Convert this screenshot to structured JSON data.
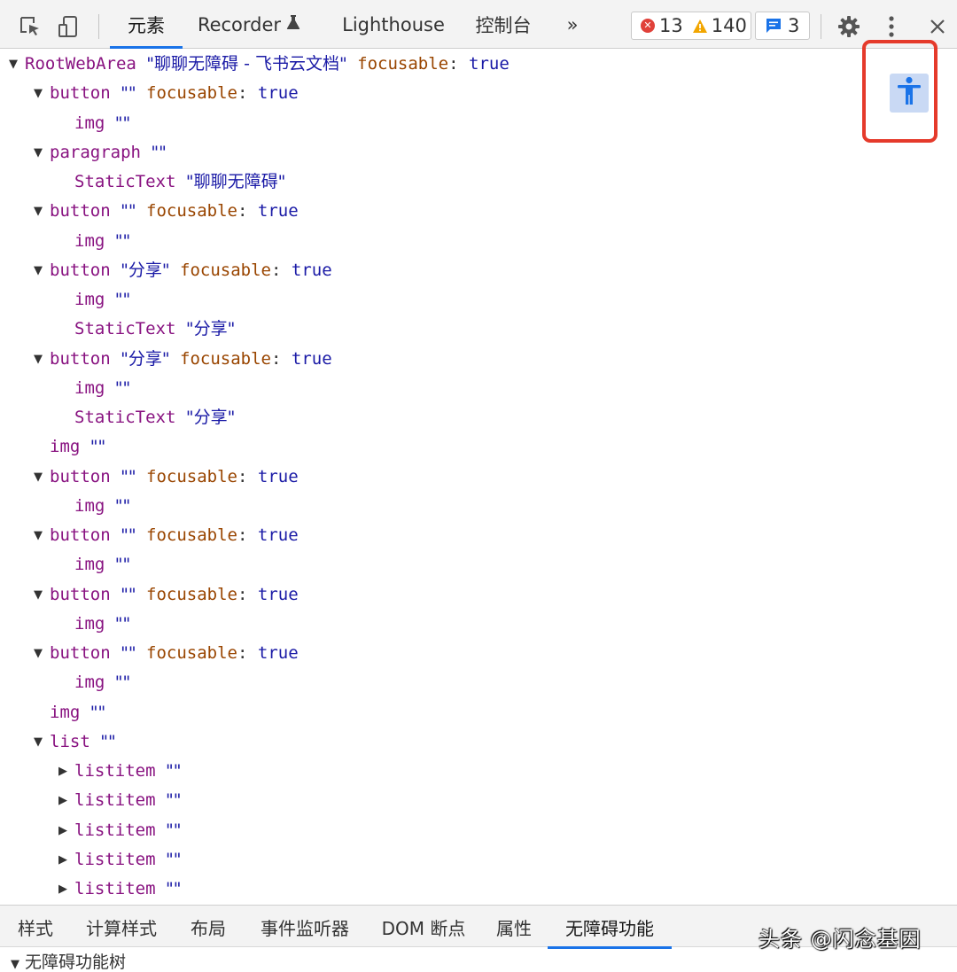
{
  "toolbar": {
    "icons": [
      "inspect-element-icon",
      "device-toolbar-icon"
    ],
    "tabs": [
      {
        "label": "元素",
        "active": true
      },
      {
        "label": "Recorder",
        "icon": "flask-icon",
        "active": false
      },
      {
        "label": "Lighthouse",
        "active": false
      },
      {
        "label": "控制台",
        "active": false
      }
    ],
    "more_tabs": "»",
    "errors": "13",
    "warnings": "140",
    "messages": "3",
    "settings_icon": "gear-icon",
    "menu_icon": "kebab-menu-icon",
    "close_icon": "close-icon"
  },
  "tree": {
    "nodes": [
      {
        "role": "RootWebArea",
        "name": "\"聊聊无障碍 - 飞书云文档\"",
        "prop": "focusable",
        "value": "true",
        "expanded": true
      },
      {
        "role": "button",
        "name": "\"\"",
        "prop": "focusable",
        "value": "true",
        "expanded": true
      },
      {
        "role": "img",
        "name": "\"\""
      },
      {
        "role": "paragraph",
        "name": "\"\"",
        "expanded": true
      },
      {
        "role": "StaticText",
        "name": "\"聊聊无障碍\""
      },
      {
        "role": "button",
        "name": "\"\"",
        "prop": "focusable",
        "value": "true",
        "expanded": true
      },
      {
        "role": "img",
        "name": "\"\""
      },
      {
        "role": "button",
        "name": "\"分享\"",
        "prop": "focusable",
        "value": "true",
        "expanded": true
      },
      {
        "role": "img",
        "name": "\"\""
      },
      {
        "role": "StaticText",
        "name": "\"分享\""
      },
      {
        "role": "button",
        "name": "\"分享\"",
        "prop": "focusable",
        "value": "true",
        "expanded": true
      },
      {
        "role": "img",
        "name": "\"\""
      },
      {
        "role": "StaticText",
        "name": "\"分享\""
      },
      {
        "role": "img",
        "name": "\"\""
      },
      {
        "role": "button",
        "name": "\"\"",
        "prop": "focusable",
        "value": "true",
        "expanded": true
      },
      {
        "role": "img",
        "name": "\"\""
      },
      {
        "role": "button",
        "name": "\"\"",
        "prop": "focusable",
        "value": "true",
        "expanded": true
      },
      {
        "role": "img",
        "name": "\"\""
      },
      {
        "role": "button",
        "name": "\"\"",
        "prop": "focusable",
        "value": "true",
        "expanded": true
      },
      {
        "role": "img",
        "name": "\"\""
      },
      {
        "role": "button",
        "name": "\"\"",
        "prop": "focusable",
        "value": "true",
        "expanded": true
      },
      {
        "role": "img",
        "name": "\"\""
      },
      {
        "role": "img",
        "name": "\"\""
      },
      {
        "role": "list",
        "name": "\"\"",
        "expanded": true
      },
      {
        "role": "listitem",
        "name": "\"\"",
        "expanded": false
      },
      {
        "role": "listitem",
        "name": "\"\"",
        "expanded": false
      },
      {
        "role": "listitem",
        "name": "\"\"",
        "expanded": false
      },
      {
        "role": "listitem",
        "name": "\"\"",
        "expanded": false
      },
      {
        "role": "listitem",
        "name": "\"\"",
        "expanded": false
      }
    ]
  },
  "a11y_button": {
    "icon": "accessibility-person-icon"
  },
  "bottom_tabs": [
    {
      "label": "样式",
      "active": false
    },
    {
      "label": "计算样式",
      "active": false
    },
    {
      "label": "布局",
      "active": false
    },
    {
      "label": "事件监听器",
      "active": false
    },
    {
      "label": "DOM 断点",
      "active": false
    },
    {
      "label": "属性",
      "active": false
    },
    {
      "label": "无障碍功能",
      "active": true
    }
  ],
  "section": {
    "title": "无障碍功能树"
  },
  "watermark": "头条 @闪念基因",
  "colors": {
    "accent": "#1a73e8",
    "highlight": "#e53a2b",
    "role": "#881280",
    "prop": "#994500",
    "value": "#1a1aa6"
  }
}
